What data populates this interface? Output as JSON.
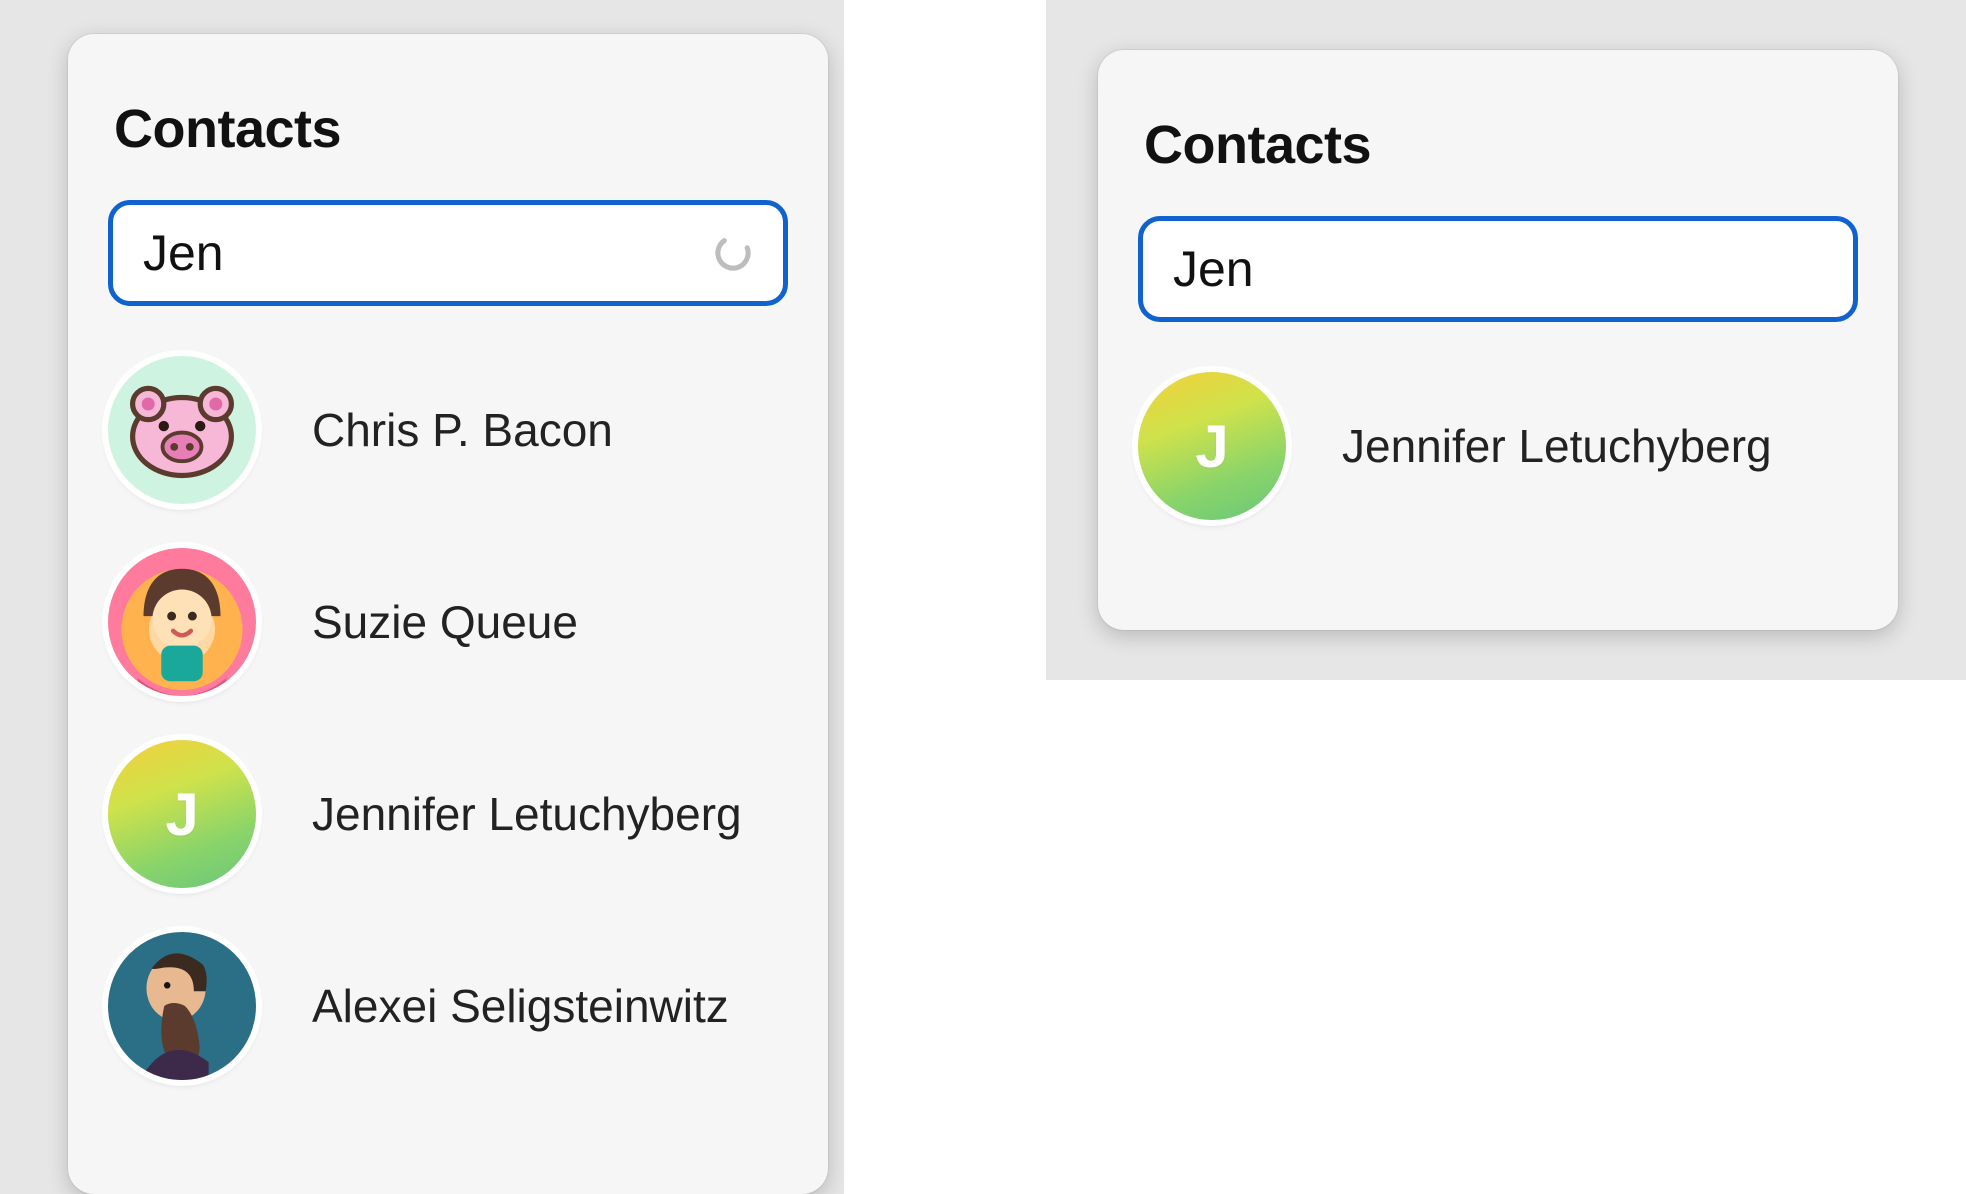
{
  "left": {
    "title": "Contacts",
    "search_value": "Jen",
    "show_spinner": true,
    "contacts": [
      {
        "name": "Chris P. Bacon",
        "avatar_kind": "pig",
        "avatar_letter": ""
      },
      {
        "name": "Suzie Queue",
        "avatar_kind": "suzie",
        "avatar_letter": ""
      },
      {
        "name": "Jennifer Letuchyberg",
        "avatar_kind": "letter",
        "avatar_letter": "J"
      },
      {
        "name": "Alexei Seligsteinwitz",
        "avatar_kind": "alex",
        "avatar_letter": ""
      }
    ]
  },
  "right": {
    "title": "Contacts",
    "search_value": "Jen",
    "show_spinner": false,
    "contacts": [
      {
        "name": "Jennifer Letuchyberg",
        "avatar_kind": "letter",
        "avatar_letter": "J"
      }
    ]
  }
}
